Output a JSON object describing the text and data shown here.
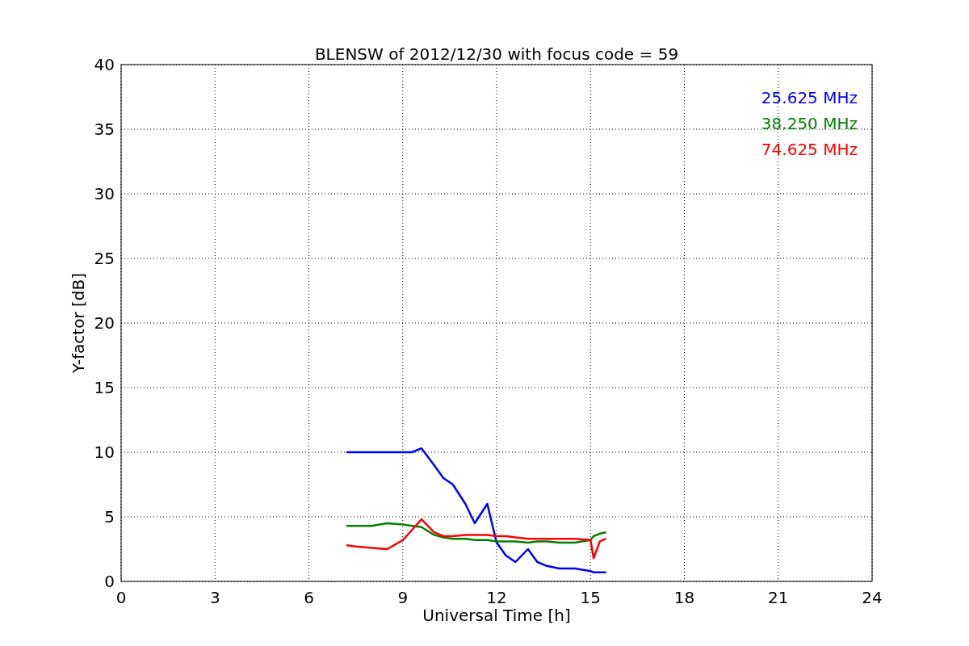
{
  "figure": {
    "chart_data": {
      "type": "line",
      "title": "BLENSW of 2012/12/30 with focus code = 59",
      "xlabel": "Universal Time [h]",
      "ylabel": "Y-factor [dB]",
      "x": [
        7.2,
        7.5,
        8,
        8.5,
        9,
        9.3,
        9.6,
        10,
        10.3,
        10.6,
        11,
        11.3,
        11.7,
        12,
        12.3,
        12.6,
        13,
        13.3,
        13.6,
        14,
        14.5,
        15,
        15.1,
        15.3,
        15.5
      ],
      "series": [
        {
          "name": "25.625 MHz",
          "color": "#0000ff",
          "values": [
            10,
            10,
            10,
            10,
            10,
            10,
            10.3,
            9,
            8,
            7.5,
            6,
            4.5,
            6,
            3,
            2,
            1.5,
            2.5,
            1.5,
            1.2,
            1,
            1,
            0.8,
            0.7,
            0.7,
            0.7
          ]
        },
        {
          "name": "38.250 MHz",
          "color": "#008000",
          "values": [
            4.3,
            4.3,
            4.3,
            4.5,
            4.4,
            4.3,
            4.2,
            3.6,
            3.4,
            3.3,
            3.3,
            3.2,
            3.2,
            3.1,
            3.1,
            3.1,
            3.0,
            3.1,
            3.1,
            3.0,
            3.0,
            3.2,
            3.5,
            3.7,
            3.8
          ]
        },
        {
          "name": "74.625 MHz",
          "color": "#ff0000",
          "values": [
            2.8,
            2.7,
            2.6,
            2.5,
            3.2,
            4,
            4.8,
            3.8,
            3.5,
            3.5,
            3.6,
            3.6,
            3.6,
            3.5,
            3.5,
            3.4,
            3.3,
            3.3,
            3.3,
            3.3,
            3.3,
            3.2,
            1.8,
            3.1,
            3.3
          ]
        }
      ],
      "xlim": [
        0,
        24
      ],
      "ylim": [
        0,
        40
      ],
      "xticks": [
        0,
        3,
        6,
        9,
        12,
        15,
        18,
        21,
        24
      ],
      "yticks": [
        0,
        5,
        10,
        15,
        20,
        25,
        30,
        35,
        40
      ],
      "grid": true
    }
  }
}
